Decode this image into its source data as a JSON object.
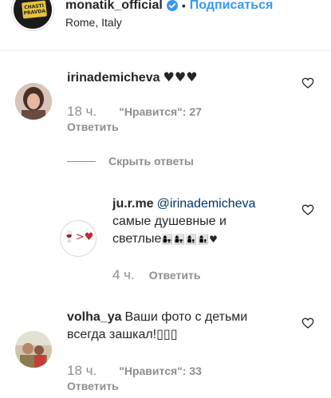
{
  "post_header": {
    "username": "monatik_official",
    "separator": "•",
    "follow_label": "Подписаться",
    "location": "Rome, Italy",
    "avatar_text": "CHASTI PRAVDA"
  },
  "comments": [
    {
      "username": "irinademicheva",
      "text": "♥♥♥",
      "time": "18 ч.",
      "likes": "\"Нравится\": 27",
      "reply_label": "Ответить"
    },
    {
      "username": "ju.r.me",
      "mention": "@irinademicheva",
      "text_line1": "самые душевные и",
      "text_line2": "светлые",
      "text_emoji": "👩‍👧👩‍👧👩‍👦👩‍👦♥",
      "time": "4 ч.",
      "reply_label": "Ответить",
      "avatar_text": "🍷>♥"
    },
    {
      "username": "volha_ya",
      "text_line1": "Ваши фото с детьми",
      "text_line2": "всегда зашкал!▯▯▯",
      "time": "18 ч.",
      "likes": "\"Нравится\": 33",
      "reply_label": "Ответить"
    }
  ],
  "hide_replies_label": "Скрыть ответы",
  "colors": {
    "link_blue": "#3897f0",
    "secondary_text": "#8e8e8e",
    "heart_red": "#ed4956"
  }
}
